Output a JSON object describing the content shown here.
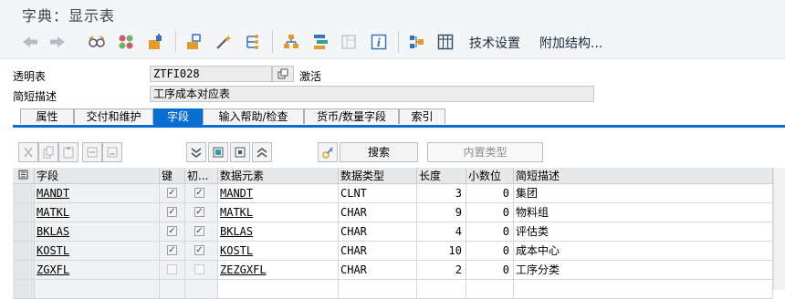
{
  "window": {
    "title": "字典：显示表"
  },
  "toolbar": {
    "tech_settings": "技术设置",
    "append_structure": "附加结构..."
  },
  "header": {
    "table_label": "透明表",
    "table_name": "ZTFI028",
    "status": "激活",
    "desc_label": "简短描述",
    "description": "工序成本对应表"
  },
  "tabs": [
    {
      "label": "属性"
    },
    {
      "label": "交付和维护"
    },
    {
      "label": "字段"
    },
    {
      "label": "输入帮助/检查"
    },
    {
      "label": "货币/数量字段"
    },
    {
      "label": "索引"
    }
  ],
  "table_toolbar": {
    "search_label": "搜索",
    "builtin_type_label": "内置类型"
  },
  "table": {
    "columns": [
      "字段",
      "键",
      "初...",
      "数据元素",
      "数据类型",
      "长度",
      "小数位",
      "简短描述"
    ],
    "rows": [
      {
        "field": "MANDT",
        "key": true,
        "init": true,
        "data_element": "MANDT",
        "type": "CLNT",
        "length": "3",
        "decimals": "0",
        "desc": "集团"
      },
      {
        "field": "MATKL",
        "key": true,
        "init": true,
        "data_element": "MATKL",
        "type": "CHAR",
        "length": "9",
        "decimals": "0",
        "desc": "物料组"
      },
      {
        "field": "BKLAS",
        "key": true,
        "init": true,
        "data_element": "BKLAS",
        "type": "CHAR",
        "length": "4",
        "decimals": "0",
        "desc": "评估类"
      },
      {
        "field": "KOSTL",
        "key": true,
        "init": true,
        "data_element": "KOSTL",
        "type": "CHAR",
        "length": "10",
        "decimals": "0",
        "desc": "成本中心"
      },
      {
        "field": "ZGXFL",
        "key": false,
        "init": false,
        "data_element": "ZEZGXFL",
        "type": "CHAR",
        "length": "2",
        "decimals": "0",
        "desc": "工序分类"
      }
    ]
  },
  "icons": [
    "back-icon",
    "forward-icon",
    "glasses-icon",
    "other-object-icon",
    "activate-icon",
    "where-used-icon",
    "magic-wand-icon",
    "hierarchy-icon",
    "object-list-icon",
    "navigate-icon",
    "display-icon",
    "info-icon",
    "structure-icon",
    "grid-icon"
  ],
  "colors": {
    "accent": "#0a6ed1",
    "titlebar": "#f3f5f7"
  }
}
